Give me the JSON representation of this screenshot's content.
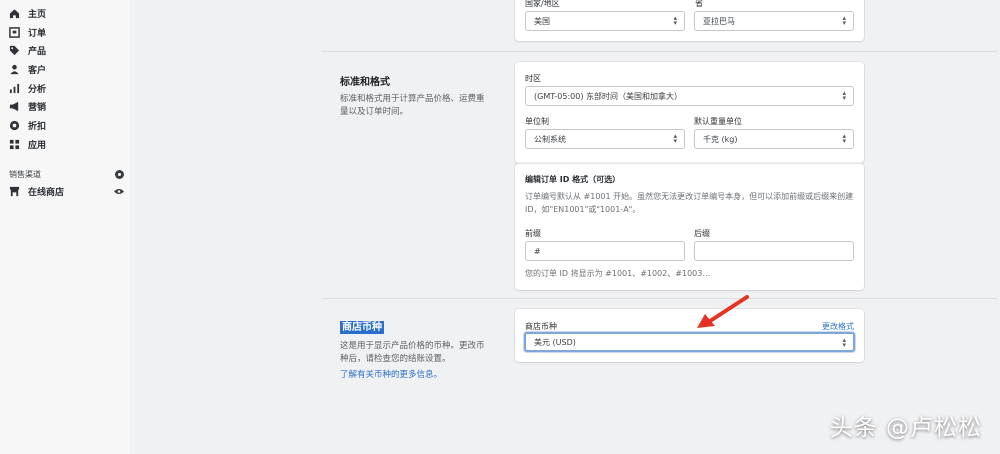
{
  "sidebar": {
    "items": [
      {
        "label": "主页",
        "icon": "home-icon"
      },
      {
        "label": "订单",
        "icon": "orders-icon"
      },
      {
        "label": "产品",
        "icon": "tag-icon"
      },
      {
        "label": "客户",
        "icon": "person-icon"
      },
      {
        "label": "分析",
        "icon": "chart-icon"
      },
      {
        "label": "营销",
        "icon": "megaphone-icon"
      },
      {
        "label": "折扣",
        "icon": "discount-icon"
      },
      {
        "label": "应用",
        "icon": "apps-icon"
      }
    ],
    "channels_header": "销售渠道",
    "channel_item": "在线商店"
  },
  "top_card": {
    "label_left": "国家/地区",
    "value_left": "美国",
    "label_right": "省",
    "value_right": "亚拉巴马"
  },
  "units_section": {
    "title": "标准和格式",
    "desc": "标准和格式用于计算产品价格、运费重量以及订单时间。",
    "timezone_label": "时区",
    "timezone_value": "(GMT-05:00) 东部时间（美国和加拿大）",
    "unit_system_label": "单位制",
    "unit_system_value": "公制系统",
    "weight_label": "默认重量单位",
    "weight_value": "千克 (kg)",
    "prefix_title": "编辑订单 ID 格式（可选）",
    "prefix_desc": "订单编号默认从 #1001 开始。虽然您无法更改订单编号本身，但可以添加前缀或后缀来创建 ID，如\"EN1001\"或\"1001-A\"。",
    "prefix_label": "前缀",
    "prefix_value": "#",
    "suffix_label": "后缀",
    "suffix_value": "",
    "preview_hint": "您的订单 ID 将显示为 #1001、#1002、#1003…"
  },
  "currency_section": {
    "title": "商店币种",
    "desc": "这是用于显示产品价格的币种。更改币种后，请检查您的结账设置。",
    "link_text": "了解有关币种的更多信息。",
    "currency_label": "商店币种",
    "change_link": "更改格式",
    "currency_value": "美元 (USD)"
  },
  "watermark": "头条 @卢松松"
}
